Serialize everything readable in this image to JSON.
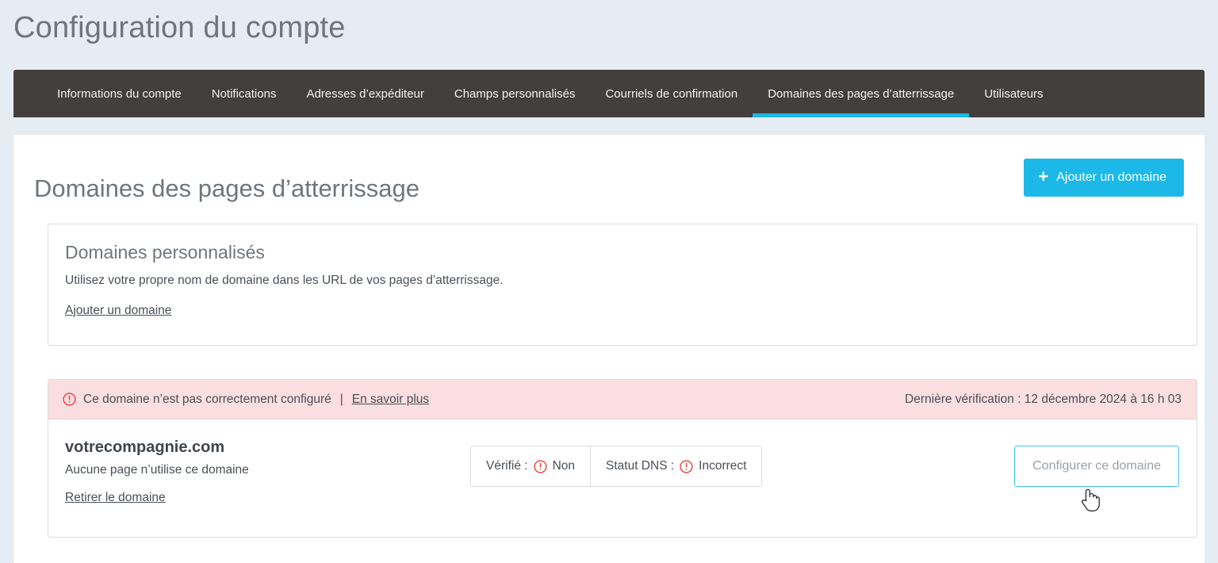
{
  "page": {
    "title": "Configuration du compte",
    "background_color": "#e6ecf3"
  },
  "nav": {
    "accent_color": "#1ab9e8",
    "background_color": "#433f3c",
    "tabs": [
      {
        "label": "Informations du compte",
        "active": false
      },
      {
        "label": "Notifications",
        "active": false
      },
      {
        "label": "Adresses d’expéditeur",
        "active": false
      },
      {
        "label": "Champs personnalisés",
        "active": false
      },
      {
        "label": "Courriels de confirmation",
        "active": false
      },
      {
        "label": "Domaines des pages d’atterrissage",
        "active": true
      },
      {
        "label": "Utilisateurs",
        "active": false
      }
    ]
  },
  "panel": {
    "title": "Domaines des pages d’atterrissage",
    "add_button": {
      "label": "Ajouter un domaine",
      "icon": "plus-icon",
      "color": "#1cb9e8"
    }
  },
  "custom_domains_card": {
    "title": "Domaines personnalisés",
    "description": "Utilisez votre propre nom de domaine dans les URL de vos pages d’atterrissage.",
    "link_label": "Ajouter un domaine"
  },
  "domain_entry": {
    "banner": {
      "icon": "alert-circle-icon",
      "message": "Ce domaine n’est pas correctement configuré",
      "separator": "|",
      "link_label": "En savoir plus",
      "last_check": "Dernière vérification : 12 décembre 2024 à 16 h 03",
      "background_color": "#fadee0",
      "icon_color": "#ee3b3b"
    },
    "name": "votrecompagnie.com",
    "subtitle": "Aucune page n’utilise ce domaine",
    "remove_link_label": "Retirer le domaine",
    "statuses": [
      {
        "label": "Vérifié :",
        "icon": "alert-circle-icon",
        "value": "Non"
      },
      {
        "label": "Statut DNS :",
        "icon": "alert-circle-icon",
        "value": "Incorrect"
      }
    ],
    "configure_button": {
      "label": "Configurer ce domaine",
      "border_color": "#3fc2ea"
    }
  },
  "cursor": {
    "icon": "pointing-hand-cursor"
  }
}
